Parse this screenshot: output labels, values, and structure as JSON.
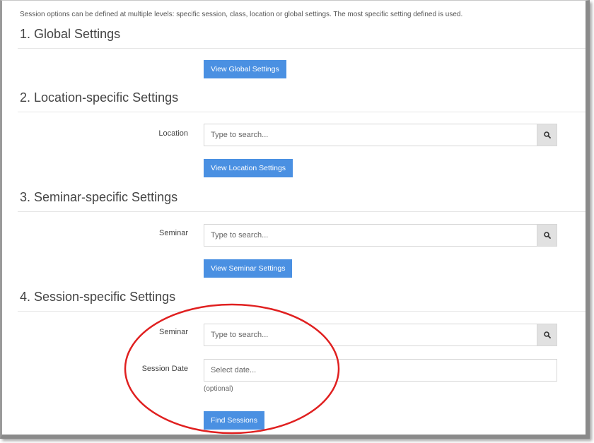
{
  "intro": "Session options can be defined at multiple levels: specific session, class, location or global settings. The most specific setting defined is used.",
  "sections": {
    "global": {
      "title": "1. Global Settings",
      "button": "View Global Settings"
    },
    "location": {
      "title": "2. Location-specific Settings",
      "field_label": "Location",
      "placeholder": "Type to search...",
      "button": "View Location Settings"
    },
    "seminar": {
      "title": "3. Seminar-specific Settings",
      "field_label": "Seminar",
      "placeholder": "Type to search...",
      "button": "View Seminar Settings"
    },
    "session": {
      "title": "4. Session-specific Settings",
      "seminar_label": "Seminar",
      "seminar_placeholder": "Type to search...",
      "date_label": "Session Date",
      "date_placeholder": "Select date...",
      "date_hint": "(optional)",
      "button": "Find Sessions"
    }
  },
  "icons": {
    "search": "search-icon"
  },
  "colors": {
    "primary_button": "#4a90e2",
    "annotation_circle": "#e02020"
  }
}
